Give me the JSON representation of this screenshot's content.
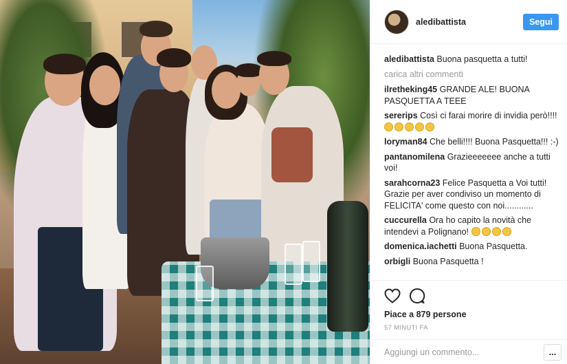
{
  "post": {
    "username": "aledibattista",
    "follow_label": "Segui",
    "caption": "Buona pasquetta a tutti!",
    "load_more_label": "carica altri commenti",
    "comments": [
      {
        "user": "ilretheking45",
        "text": "GRANDE ALE! BUONA PASQUETTA A TEEE"
      },
      {
        "user": "sererips",
        "text": "Così ci farai morire di invidia però!!!!",
        "emoji_count": 5
      },
      {
        "user": "loryman84",
        "text": "Che belli!!!! Buona Pasquetta!!! :-)"
      },
      {
        "user": "pantanomilena",
        "text": "Grazieeeeeee anche a tutti voi!"
      },
      {
        "user": "sarahcorna23",
        "text": "Felice Pasquetta a Voi tutti! Grazie per aver condiviso un momento di FELICITA' come questo con noi............"
      },
      {
        "user": "cuccurella",
        "text": "Ora ho capito la novità che intendevi a Polignano!",
        "emoji_count": 4
      },
      {
        "user": "domenica.iachetti",
        "text": "Buona Pasquetta."
      },
      {
        "user": "orbigli",
        "text": "Buona Pasquetta !"
      }
    ],
    "likes": "Piace a 879 persone",
    "time_ago": "57 MINUTI FA",
    "comment_placeholder": "Aggiungi un commento...",
    "more_label": "..."
  },
  "icons": {
    "like": "heart-icon",
    "comment": "speech-bubble-icon",
    "emoji": "emoji-face-icon"
  },
  "colors": {
    "accent": "#3897f0",
    "muted": "#999999",
    "text": "#262626"
  }
}
